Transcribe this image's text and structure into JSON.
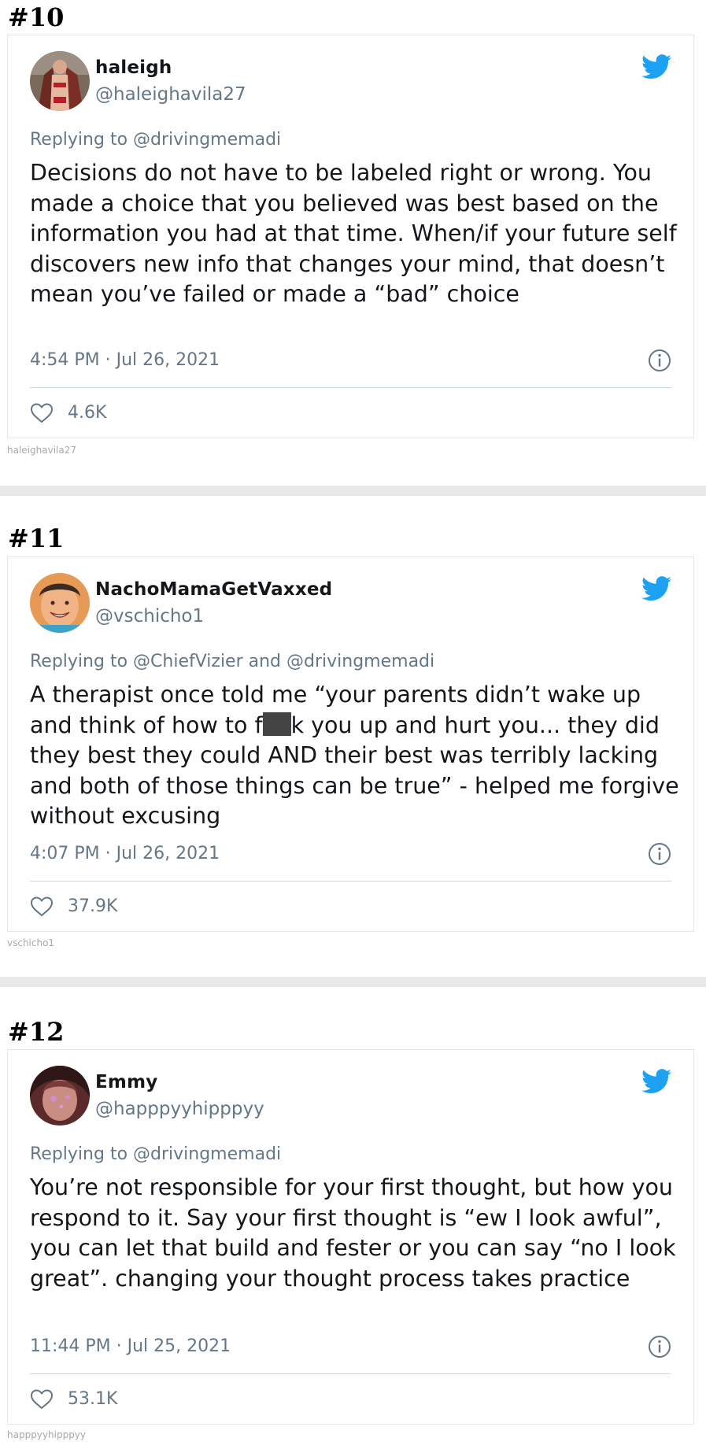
{
  "posts": [
    {
      "number": "#10",
      "display_name": "haleigh",
      "handle": "@haleighavila27",
      "replying_to": "Replying to @drivingmemadi",
      "text": "Decisions do not have to be labeled right or wrong. You made a choice that you believed was best based on the information you had at that time. When/if your future self discovers new info that changes your mind, that doesn’t mean you’ve failed or made a “bad” choice",
      "timestamp": "4:54 PM · Jul 26, 2021",
      "likes": "4.6K",
      "watermark": "haleighavila27"
    },
    {
      "number": "#11",
      "display_name": "NachoMamaGetVaxxed",
      "handle": "@vschicho1",
      "replying_to": "Replying to @ChiefVizier and @drivingmemadi",
      "text_before": "A therapist once told me “your parents didn’t wake up and think of how to f",
      "text_after": "k you up and hurt you... they did they best they could AND their best was terribly lacking and both of those things can be true” - helped me forgive without excusing",
      "timestamp": "4:07 PM · Jul 26, 2021",
      "likes": "37.9K",
      "watermark": "vschicho1"
    },
    {
      "number": "#12",
      "display_name": "Emmy",
      "handle": "@happpyyhipppyy",
      "replying_to": "Replying to @drivingmemadi",
      "text": "You’re not responsible for your first thought, but how you respond to it. Say your first thought is “ew I look awful”, you can let that build and fester or you can say “no I look great”. changing your thought process  takes practice",
      "timestamp": "11:44 PM · Jul 25, 2021",
      "likes": "53.1K",
      "watermark": "happpyyhipppyy"
    }
  ],
  "colors": {
    "twitter_blue": "#1da1f2",
    "secondary_text": "#657786",
    "primary_text": "#14171a"
  },
  "icons": [
    "twitter-bird-icon",
    "info-icon",
    "heart-icon"
  ]
}
